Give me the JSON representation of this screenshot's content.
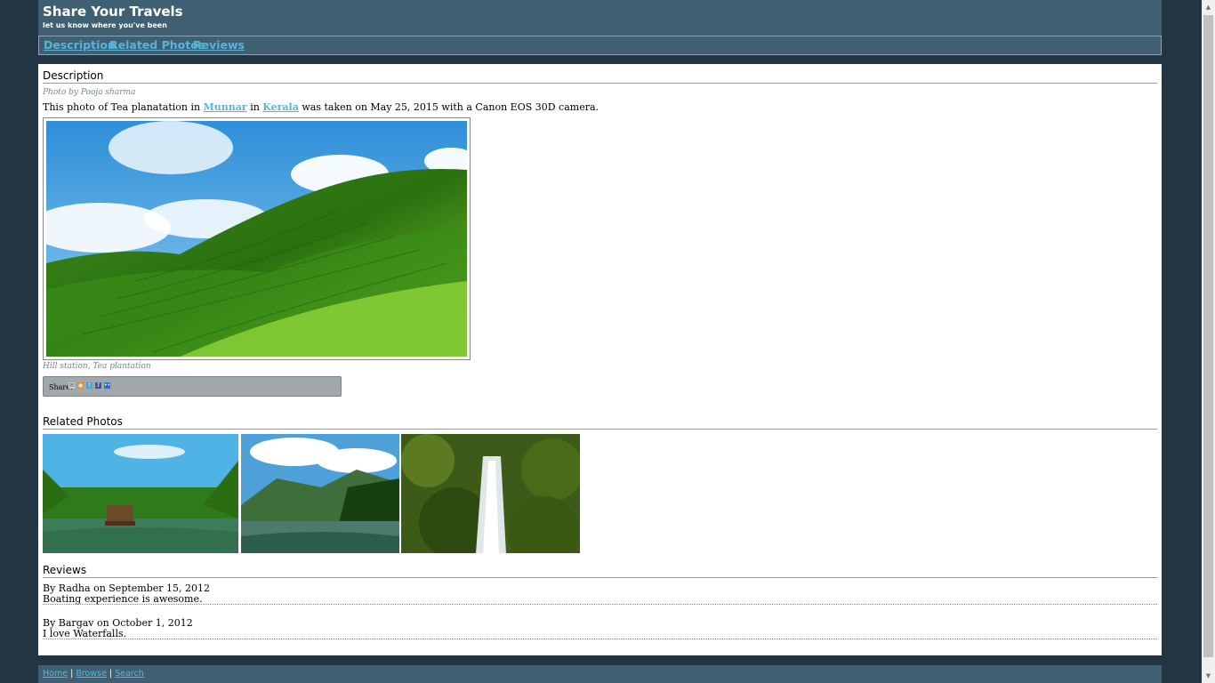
{
  "header": {
    "title": "Share Your Travels",
    "subtitle": "let us know where you've been"
  },
  "nav": {
    "items": [
      "Description",
      "Related Photos",
      "Reviews"
    ]
  },
  "description": {
    "heading": "Description",
    "byline": "Photo by Pooja sharma",
    "text_prefix": "This photo of Tea planatation in",
    "city": "Munnar",
    "text_mid": "in",
    "region": "Kerala",
    "text_suffix": "was taken on May 25, 2015 with a Canon EOS 30D camera.",
    "tags": "Hill station, Tea plantation",
    "share_label": "Share:",
    "share_icons": [
      "email-icon",
      "rss-icon",
      "twitter-icon",
      "facebook-icon",
      "flickr-icon"
    ]
  },
  "related": {
    "heading": "Related Photos"
  },
  "reviews": {
    "heading": "Reviews",
    "items": [
      {
        "by": "By Radha on September 15, 2012",
        "text": "Boating experience is awesome."
      },
      {
        "by": "By Bargav on October 1, 2012",
        "text": "I love Waterfalls."
      }
    ]
  },
  "footer": {
    "links": [
      "Home",
      "Browse",
      "Search"
    ],
    "separator": "|"
  }
}
